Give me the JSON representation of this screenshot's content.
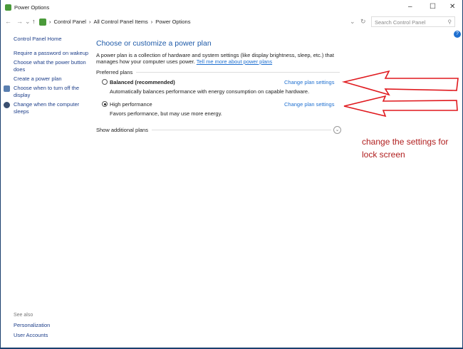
{
  "window": {
    "title": "Power Options",
    "minimize": "–",
    "maximize": "☐",
    "close": "✕"
  },
  "address": {
    "back": "←",
    "forward": "→",
    "recent": "⌄",
    "up": "↑",
    "crumbs": [
      "Control Panel",
      "All Control Panel Items",
      "Power Options"
    ],
    "sep": "›",
    "dropdown": "⌄",
    "refresh": "↻",
    "search_placeholder": "Search Control Panel",
    "search_icon": "⚲"
  },
  "help": "?",
  "sidebar": {
    "home": "Control Panel Home",
    "items": [
      "Require a password on wakeup",
      "Choose what the power button does",
      "Create a power plan",
      "Choose when to turn off the display",
      "Change when the computer sleeps"
    ],
    "see_also": "See also",
    "see_also_items": [
      "Personalization",
      "User Accounts"
    ]
  },
  "main": {
    "title": "Choose or customize a power plan",
    "description": "A power plan is a collection of hardware and system settings (like display brightness, sleep, etc.) that manages how your computer uses power.",
    "more_link": "Tell me more about power plans",
    "preferred": "Preferred plans",
    "plans": [
      {
        "name": "Balanced (recommended)",
        "desc": "Automatically balances performance with energy consumption on capable hardware.",
        "selected": false,
        "link": "Change plan settings"
      },
      {
        "name": "High performance",
        "desc": "Favors performance, but may use more energy.",
        "selected": true,
        "link": "Change plan settings"
      }
    ],
    "show_more": "Show additional plans"
  },
  "annotation": {
    "text": "change the settings for lock screen",
    "color": "#e0191e"
  }
}
